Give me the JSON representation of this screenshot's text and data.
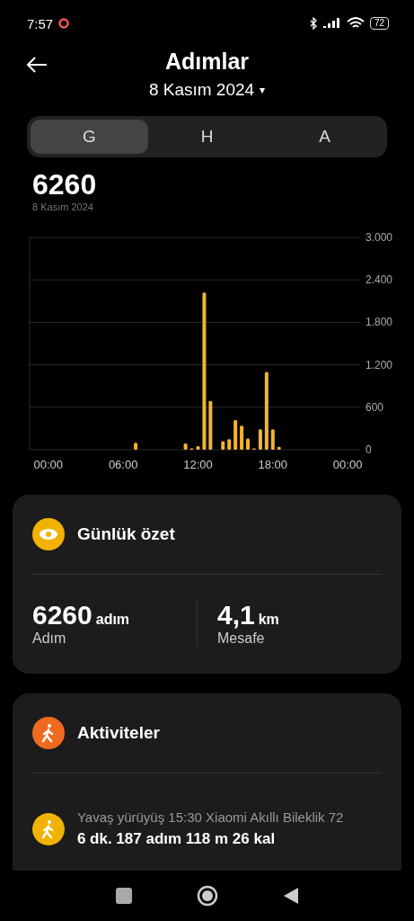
{
  "status_bar": {
    "time": "7:57",
    "battery": "72"
  },
  "header": {
    "title": "Adımlar",
    "date": "8 Kasım 2024",
    "date_caret": "▾"
  },
  "tabs": [
    {
      "label": "G",
      "selected": true
    },
    {
      "label": "H",
      "selected": false
    },
    {
      "label": "A",
      "selected": false
    }
  ],
  "total": {
    "value": "6260",
    "date": "8 Kasım 2024"
  },
  "chart_data": {
    "type": "bar",
    "x": [
      7,
      11,
      11.5,
      12,
      12.5,
      13,
      14,
      14.5,
      15,
      15.5,
      16,
      16.5,
      17,
      17.5,
      18,
      18.5
    ],
    "grid": true,
    "series": [
      {
        "color": "#f2b430",
        "values": [
          100,
          90,
          20,
          50,
          2220,
          690,
          120,
          150,
          420,
          340,
          160,
          20,
          290,
          1100,
          290,
          40
        ]
      }
    ],
    "xlim": [
      -1.5,
      25
    ],
    "ylim": [
      0,
      3000
    ],
    "xticks": [
      {
        "value": 0,
        "label": "00:00"
      },
      {
        "value": 6,
        "label": "06:00"
      },
      {
        "value": 12,
        "label": "12:00"
      },
      {
        "value": 18,
        "label": "18:00"
      },
      {
        "value": 24,
        "label": "00:00"
      }
    ],
    "yticks": [
      {
        "value": 0,
        "label": "0"
      },
      {
        "value": 600,
        "label": "600"
      },
      {
        "value": 1200,
        "label": "1.200"
      },
      {
        "value": 1800,
        "label": "1.800"
      },
      {
        "value": 2400,
        "label": "2.400"
      },
      {
        "value": 3000,
        "label": "3.000"
      }
    ]
  },
  "summary": {
    "title": "Günlük özet",
    "stats": [
      {
        "value": "6260",
        "unit": "adım",
        "label": "Adım"
      },
      {
        "value": "4,1",
        "unit": "km",
        "label": "Mesafe"
      }
    ]
  },
  "activities": {
    "title": "Aktiviteler",
    "items": [
      {
        "title": "Yavaş yürüyüş 15:30 Xiaomi Akıllı Bileklik 72",
        "details": "6 dk. 187 adım 118 m 26 kal"
      }
    ]
  }
}
